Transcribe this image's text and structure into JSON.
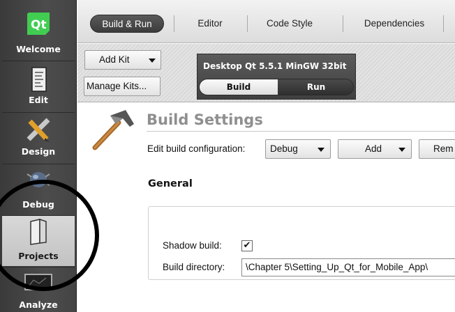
{
  "sidebar": {
    "items": [
      {
        "label": "Welcome",
        "icon": "qt-logo-icon"
      },
      {
        "label": "Edit",
        "icon": "document-icon"
      },
      {
        "label": "Design",
        "icon": "pencil-ruler-icon"
      },
      {
        "label": "Debug",
        "icon": "bug-icon"
      },
      {
        "label": "Projects",
        "icon": "folder-icon"
      },
      {
        "label": "Analyze",
        "icon": "monitor-icon"
      }
    ],
    "logo_text": "Qt"
  },
  "tabs": {
    "items": [
      "Build & Run",
      "Editor",
      "Code Style",
      "Dependencies"
    ],
    "active": "Build & Run"
  },
  "kits": {
    "add_kit_label": "Add Kit",
    "manage_kits_label": "Manage Kits...",
    "kit_name": "Desktop Qt 5.5.1 MinGW 32bit",
    "build_label": "Build",
    "run_label": "Run"
  },
  "build_settings": {
    "title": "Build Settings",
    "edit_config_label": "Edit build configuration:",
    "config_value": "Debug",
    "add_label": "Add",
    "remove_label": "Rem",
    "section_title": "General",
    "shadow_build_label": "Shadow build:",
    "shadow_build_checked": "✔",
    "build_dir_label": "Build directory:",
    "build_dir_value": "\\Chapter 5\\Setting_Up_Qt_for_Mobile_App\\"
  }
}
